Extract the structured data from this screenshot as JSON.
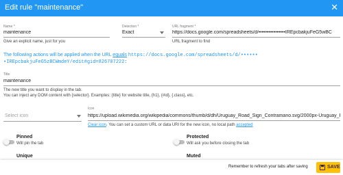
{
  "dialog": {
    "title": "Edit rule \"maintenance\"",
    "close_glyph": "✕"
  },
  "name_field": {
    "label": "Name *",
    "value": "maintenance",
    "help": "Give an explicit name, just for you"
  },
  "detection_field": {
    "label": "Detection *",
    "value": "Exact"
  },
  "url_fragment_field": {
    "label": "URL fragment *",
    "value": "https://docs.google.com/spreadsheets/d/••••••••••••••••IREpcbakjuFeG5wBC",
    "help": "URL fragment to find"
  },
  "applied_notice": {
    "prefix": "The following actions will be applied when the URL",
    "link": "equals",
    "url_line1": "https://docs.google.com/spreadsheets/d/••••••",
    "url_line2": "•IREpcbakjuFeG5zBCWmdeY/edit#gid=826707222:"
  },
  "title_field": {
    "label": "Title",
    "value": "maintenance",
    "help_line1": "The new title you want to display in the tab.",
    "help_line2": "You can inject any DOM content with {selector}. Examples: {title} for website title, {h1}, {#id}, {.class}, etc."
  },
  "icon_select": {
    "placeholder": "Select icon"
  },
  "icon_field": {
    "label": "Icon",
    "value": "https://upload.wikimedia.org/wikipedia/commons/thumb/d/dh/Uruguay_Road_Sign_Contramano.svg/2000px-Uruguay_Road_Sign_C",
    "clear_link": "Clear icon",
    "help": ". You can set a custom URL or data URI for the new icon, no local path",
    "accepted_link": "accepted"
  },
  "toggles": {
    "pinned": {
      "title": "Pinned",
      "desc": "Will pin the tab"
    },
    "protected": {
      "title": "Protected",
      "desc": "Will ask you before closing the tab"
    }
  },
  "sections": {
    "unique": "Unique",
    "muted": "Muted"
  },
  "footer": {
    "reminder": "Remember to refresh your tabs after saving",
    "save_label": "SAVE"
  },
  "colors": {
    "primary": "#2196f3",
    "accent": "#ffc107"
  },
  "icons": {
    "close": "close-icon",
    "save": "floppy-disk-icon",
    "dropdown": "chevron-down-icon"
  }
}
